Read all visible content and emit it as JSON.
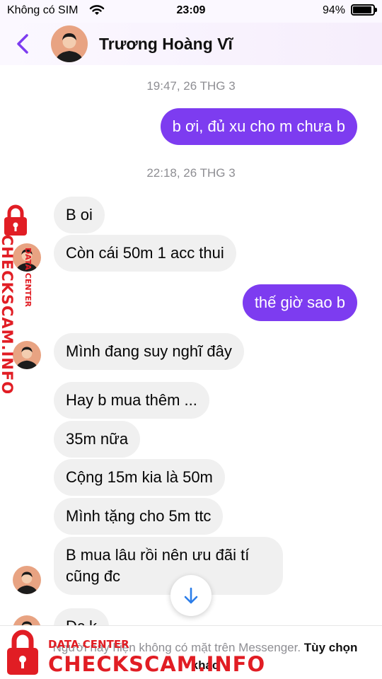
{
  "status_bar": {
    "carrier": "Không có SIM",
    "time": "23:09",
    "battery_percent": "94%",
    "battery_level": 0.94
  },
  "header": {
    "contact_name": "Trương Hoàng Vĩ",
    "accent_color": "#7d3cf0"
  },
  "conversation": {
    "timestamps": [
      "19:47, 26 THG 3",
      "22:18, 26 THG 3"
    ],
    "messages": [
      {
        "direction": "out",
        "text": "b ơi, đủ xu cho m chưa b"
      },
      {
        "direction": "in",
        "text": "B oi"
      },
      {
        "direction": "in",
        "text": "Còn cái 50m 1 acc thui"
      },
      {
        "direction": "out",
        "text": "thế giờ sao b"
      },
      {
        "direction": "in",
        "text": "Mình đang suy nghĩ đây"
      },
      {
        "direction": "in",
        "text": "Hay b mua thêm ..."
      },
      {
        "direction": "in",
        "text": "35m nữa"
      },
      {
        "direction": "in",
        "text": "Cộng 15m kia là 50m"
      },
      {
        "direction": "in",
        "text": "Mình tặng cho 5m ttc"
      },
      {
        "direction": "in",
        "text": "B mua lâu rồi nên ưu đãi tí cũng đc"
      },
      {
        "direction": "in",
        "text": "Đc k"
      }
    ],
    "colors": {
      "incoming_bubble": "#f0f0f0",
      "outgoing_bubble": "#7d3cf0"
    }
  },
  "footer": {
    "notice": "Người này hiện không có mặt trên Messenger.",
    "options_label": "Tùy chọn khác"
  },
  "watermark": {
    "brand": "CHECKSCAM.INFO",
    "subtitle": "DATA CENTER",
    "color": "#e11d24"
  }
}
